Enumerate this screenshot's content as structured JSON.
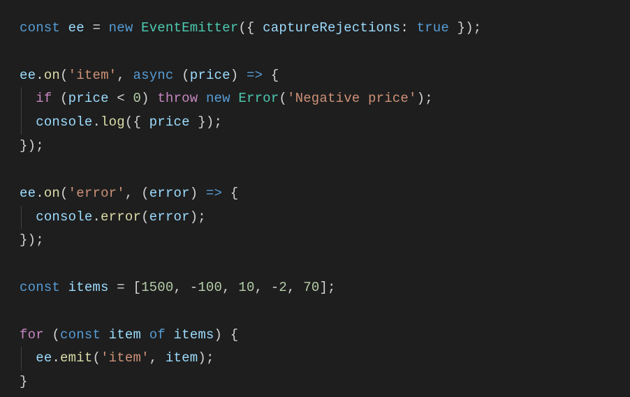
{
  "code": {
    "l1": {
      "kw_const": "const",
      "var_ee": "ee",
      "op_eq": " = ",
      "kw_new": "new",
      "cls_event": "EventEmitter",
      "paren_open": "({ ",
      "prop_cap": "captureRejections",
      "colon": ":",
      "sp": " ",
      "val_true": "true",
      "paren_close": " });"
    },
    "l3": {
      "var_ee": "ee",
      "dot": ".",
      "fn_on": "on",
      "open": "(",
      "str_item": "'item'",
      "comma": ", ",
      "kw_async": "async",
      "sp": " ",
      "open_p": "(",
      "var_price": "price",
      "close_p": ")",
      "arrow": " => ",
      "brace": "{"
    },
    "l4": {
      "indent": "  ",
      "kw_if": "if",
      "sp": " ",
      "open": "(",
      "var_price": "price",
      "lt": " < ",
      "num_0": "0",
      "close": ") ",
      "kw_throw": "throw",
      "sp2": " ",
      "kw_new": "new",
      "sp3": " ",
      "cls_err": "Error",
      "open2": "(",
      "str_neg": "'Negative price'",
      "close2": ");"
    },
    "l5": {
      "indent": "  ",
      "var_console": "console",
      "dot": ".",
      "fn_log": "log",
      "open": "({ ",
      "var_price": "price",
      "close": " });"
    },
    "l6": {
      "close": "});"
    },
    "l8": {
      "var_ee": "ee",
      "dot": ".",
      "fn_on": "on",
      "open": "(",
      "str_error": "'error'",
      "comma": ", ",
      "open_p": "(",
      "var_error": "error",
      "close_p": ")",
      "arrow": " => ",
      "brace": "{"
    },
    "l9": {
      "indent": "  ",
      "var_console": "console",
      "dot": ".",
      "fn_error": "error",
      "open": "(",
      "var_error": "error",
      "close": ");"
    },
    "l10": {
      "close": "});"
    },
    "l12": {
      "kw_const": "const",
      "sp": " ",
      "var_items": "items",
      "op_eq": " = [",
      "n1": "1500",
      "c1": ", ",
      "n2": "-",
      "n2b": "100",
      "c2": ", ",
      "n3": "10",
      "c3": ", ",
      "n4": "-",
      "n4b": "2",
      "c4": ", ",
      "n5": "70",
      "close": "];"
    },
    "l14": {
      "kw_for": "for",
      "sp": " ",
      "open": "(",
      "kw_const": "const",
      "sp2": " ",
      "var_item": "item",
      "sp3": " ",
      "kw_of": "of",
      "sp4": " ",
      "var_items": "items",
      "close": ") {"
    },
    "l15": {
      "indent": "  ",
      "var_ee": "ee",
      "dot": ".",
      "fn_emit": "emit",
      "open": "(",
      "str_item": "'item'",
      "comma": ", ",
      "var_item": "item",
      "close": ");"
    },
    "l16": {
      "close": "}"
    }
  }
}
